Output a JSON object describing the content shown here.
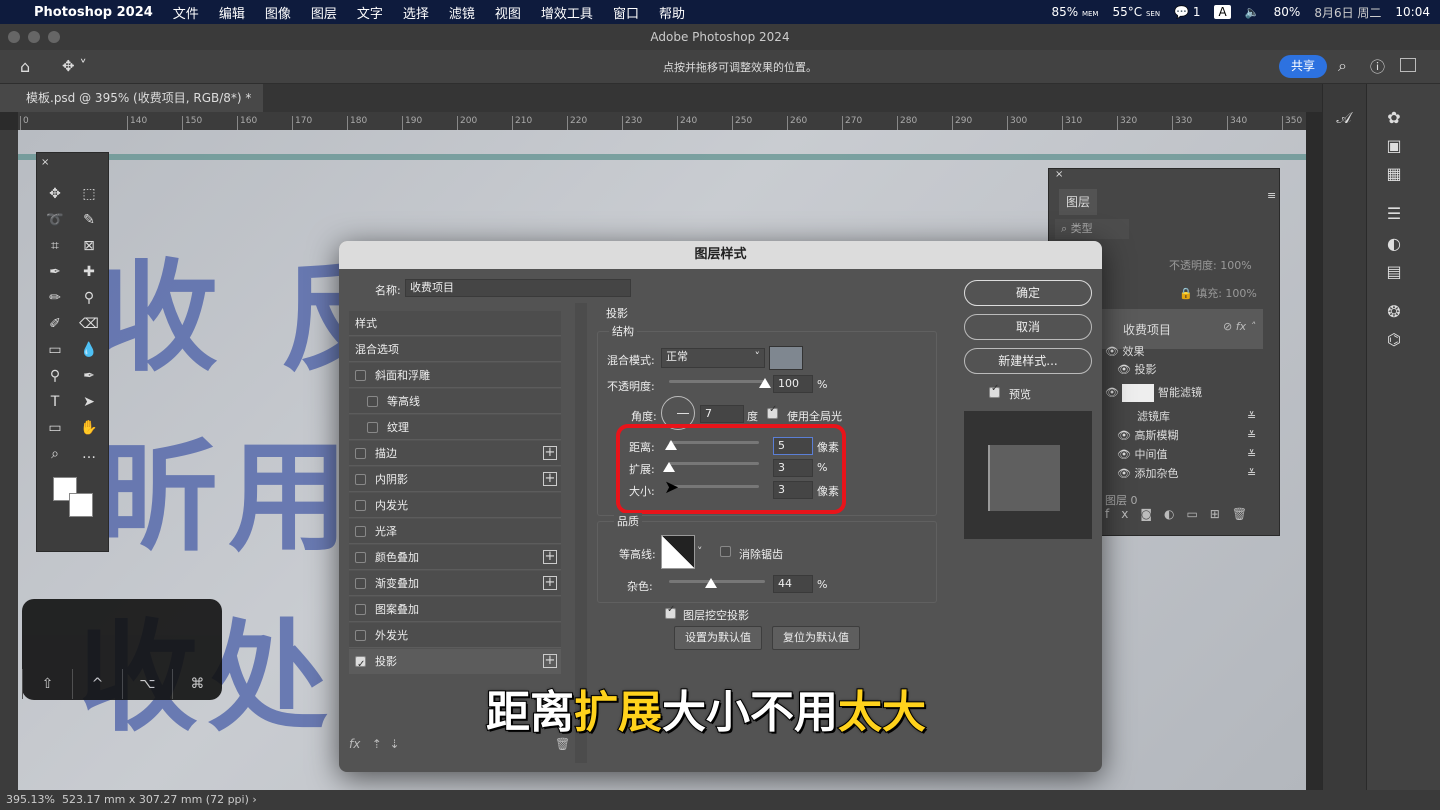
{
  "menubar": {
    "app": "Photoshop 2024",
    "items": [
      "文件",
      "编辑",
      "图像",
      "图层",
      "文字",
      "选择",
      "滤镜",
      "视图",
      "增效工具",
      "窗口",
      "帮助"
    ],
    "status": {
      "mem": "85%",
      "mem_label": "MEM",
      "temp": "55°C",
      "temp_label": "SEN",
      "wechat_count": "1",
      "input": "A",
      "battery": "80%",
      "date": "8月6日 周二",
      "time": "10:04"
    }
  },
  "window": {
    "title": "Adobe Photoshop 2024"
  },
  "options": {
    "hint": "点按并拖移可调整效果的位置。",
    "share": "共享"
  },
  "doc_tab": {
    "label": "模板.psd @ 395% (收费项目, RGB/8*) *"
  },
  "ruler": {
    "ticks": [
      "0",
      "140",
      "150",
      "160",
      "170",
      "180",
      "190",
      "200",
      "210",
      "220",
      "230",
      "240",
      "250",
      "260",
      "270",
      "280",
      "290",
      "300",
      "310",
      "320",
      "330",
      "340",
      "350"
    ]
  },
  "statusbar": {
    "zoom": "395.13%",
    "info": "523.17 mm x 307.27 mm (72 ppi)"
  },
  "keys": [
    "⇧",
    "^",
    "⌥",
    "⌘"
  ],
  "layers_panel": {
    "tab": "图层",
    "filter": "类型",
    "opacity_label": "不透明度:",
    "opacity": "100%",
    "fill_label": "填充:",
    "fill": "100%",
    "layer_name": "收费项目",
    "effects": "效果",
    "drop_shadow": "投影",
    "smart_filters": "智能滤镜",
    "filters": [
      "滤镜库",
      "高斯模糊",
      "中间值",
      "添加杂色"
    ],
    "next_layer": "图层 0"
  },
  "dialog": {
    "title": "图层样式",
    "name_label": "名称:",
    "name_value": "收费项目",
    "styles": [
      {
        "label": "样式",
        "checkbox": false,
        "checked": false,
        "plus": false,
        "indent": 0
      },
      {
        "label": "混合选项",
        "checkbox": false,
        "checked": false,
        "plus": false,
        "indent": 0
      },
      {
        "label": "斜面和浮雕",
        "checkbox": true,
        "checked": false,
        "plus": false,
        "indent": 0
      },
      {
        "label": "等高线",
        "checkbox": true,
        "checked": false,
        "plus": false,
        "indent": 1
      },
      {
        "label": "纹理",
        "checkbox": true,
        "checked": false,
        "plus": false,
        "indent": 1
      },
      {
        "label": "描边",
        "checkbox": true,
        "checked": false,
        "plus": true,
        "indent": 0
      },
      {
        "label": "内阴影",
        "checkbox": true,
        "checked": false,
        "plus": true,
        "indent": 0
      },
      {
        "label": "内发光",
        "checkbox": true,
        "checked": false,
        "plus": false,
        "indent": 0
      },
      {
        "label": "光泽",
        "checkbox": true,
        "checked": false,
        "plus": false,
        "indent": 0
      },
      {
        "label": "颜色叠加",
        "checkbox": true,
        "checked": false,
        "plus": true,
        "indent": 0
      },
      {
        "label": "渐变叠加",
        "checkbox": true,
        "checked": false,
        "plus": true,
        "indent": 0
      },
      {
        "label": "图案叠加",
        "checkbox": true,
        "checked": false,
        "plus": false,
        "indent": 0
      },
      {
        "label": "外发光",
        "checkbox": true,
        "checked": false,
        "plus": false,
        "indent": 0
      },
      {
        "label": "投影",
        "checkbox": true,
        "checked": true,
        "plus": true,
        "indent": 0
      }
    ],
    "section": "投影",
    "structure": "结构",
    "blend_label": "混合模式:",
    "blend_value": "正常",
    "shadow_color": "#7f8790",
    "opacity_label": "不透明度:",
    "opacity": "100",
    "opacity_unit": "%",
    "opacity_pct": 100,
    "angle_label": "角度:",
    "angle": "7",
    "angle_unit": "度",
    "global_light": "使用全局光",
    "global_light_checked": true,
    "distance_label": "距离:",
    "distance": "5",
    "distance_unit": "像素",
    "spread_label": "扩展:",
    "spread": "3",
    "spread_unit": "%",
    "size_label": "大小:",
    "size": "3",
    "size_unit": "像素",
    "quality": "品质",
    "contour_label": "等高线:",
    "antialias": "消除锯齿",
    "noise_label": "杂色:",
    "noise": "44",
    "noise_unit": "%",
    "noise_pct": 44,
    "knockout": "图层挖空投影",
    "set_default": "设置为默认值",
    "reset_default": "复位为默认值",
    "ok": "确定",
    "cancel": "取消",
    "new_style": "新建样式...",
    "preview": "预览",
    "highlight_color": "#e8141a"
  },
  "caption": {
    "part1": "距离",
    "part2": "扩展",
    "part3": "大小不用",
    "part4": "太大",
    "highlight_color": "#ffd21c"
  }
}
